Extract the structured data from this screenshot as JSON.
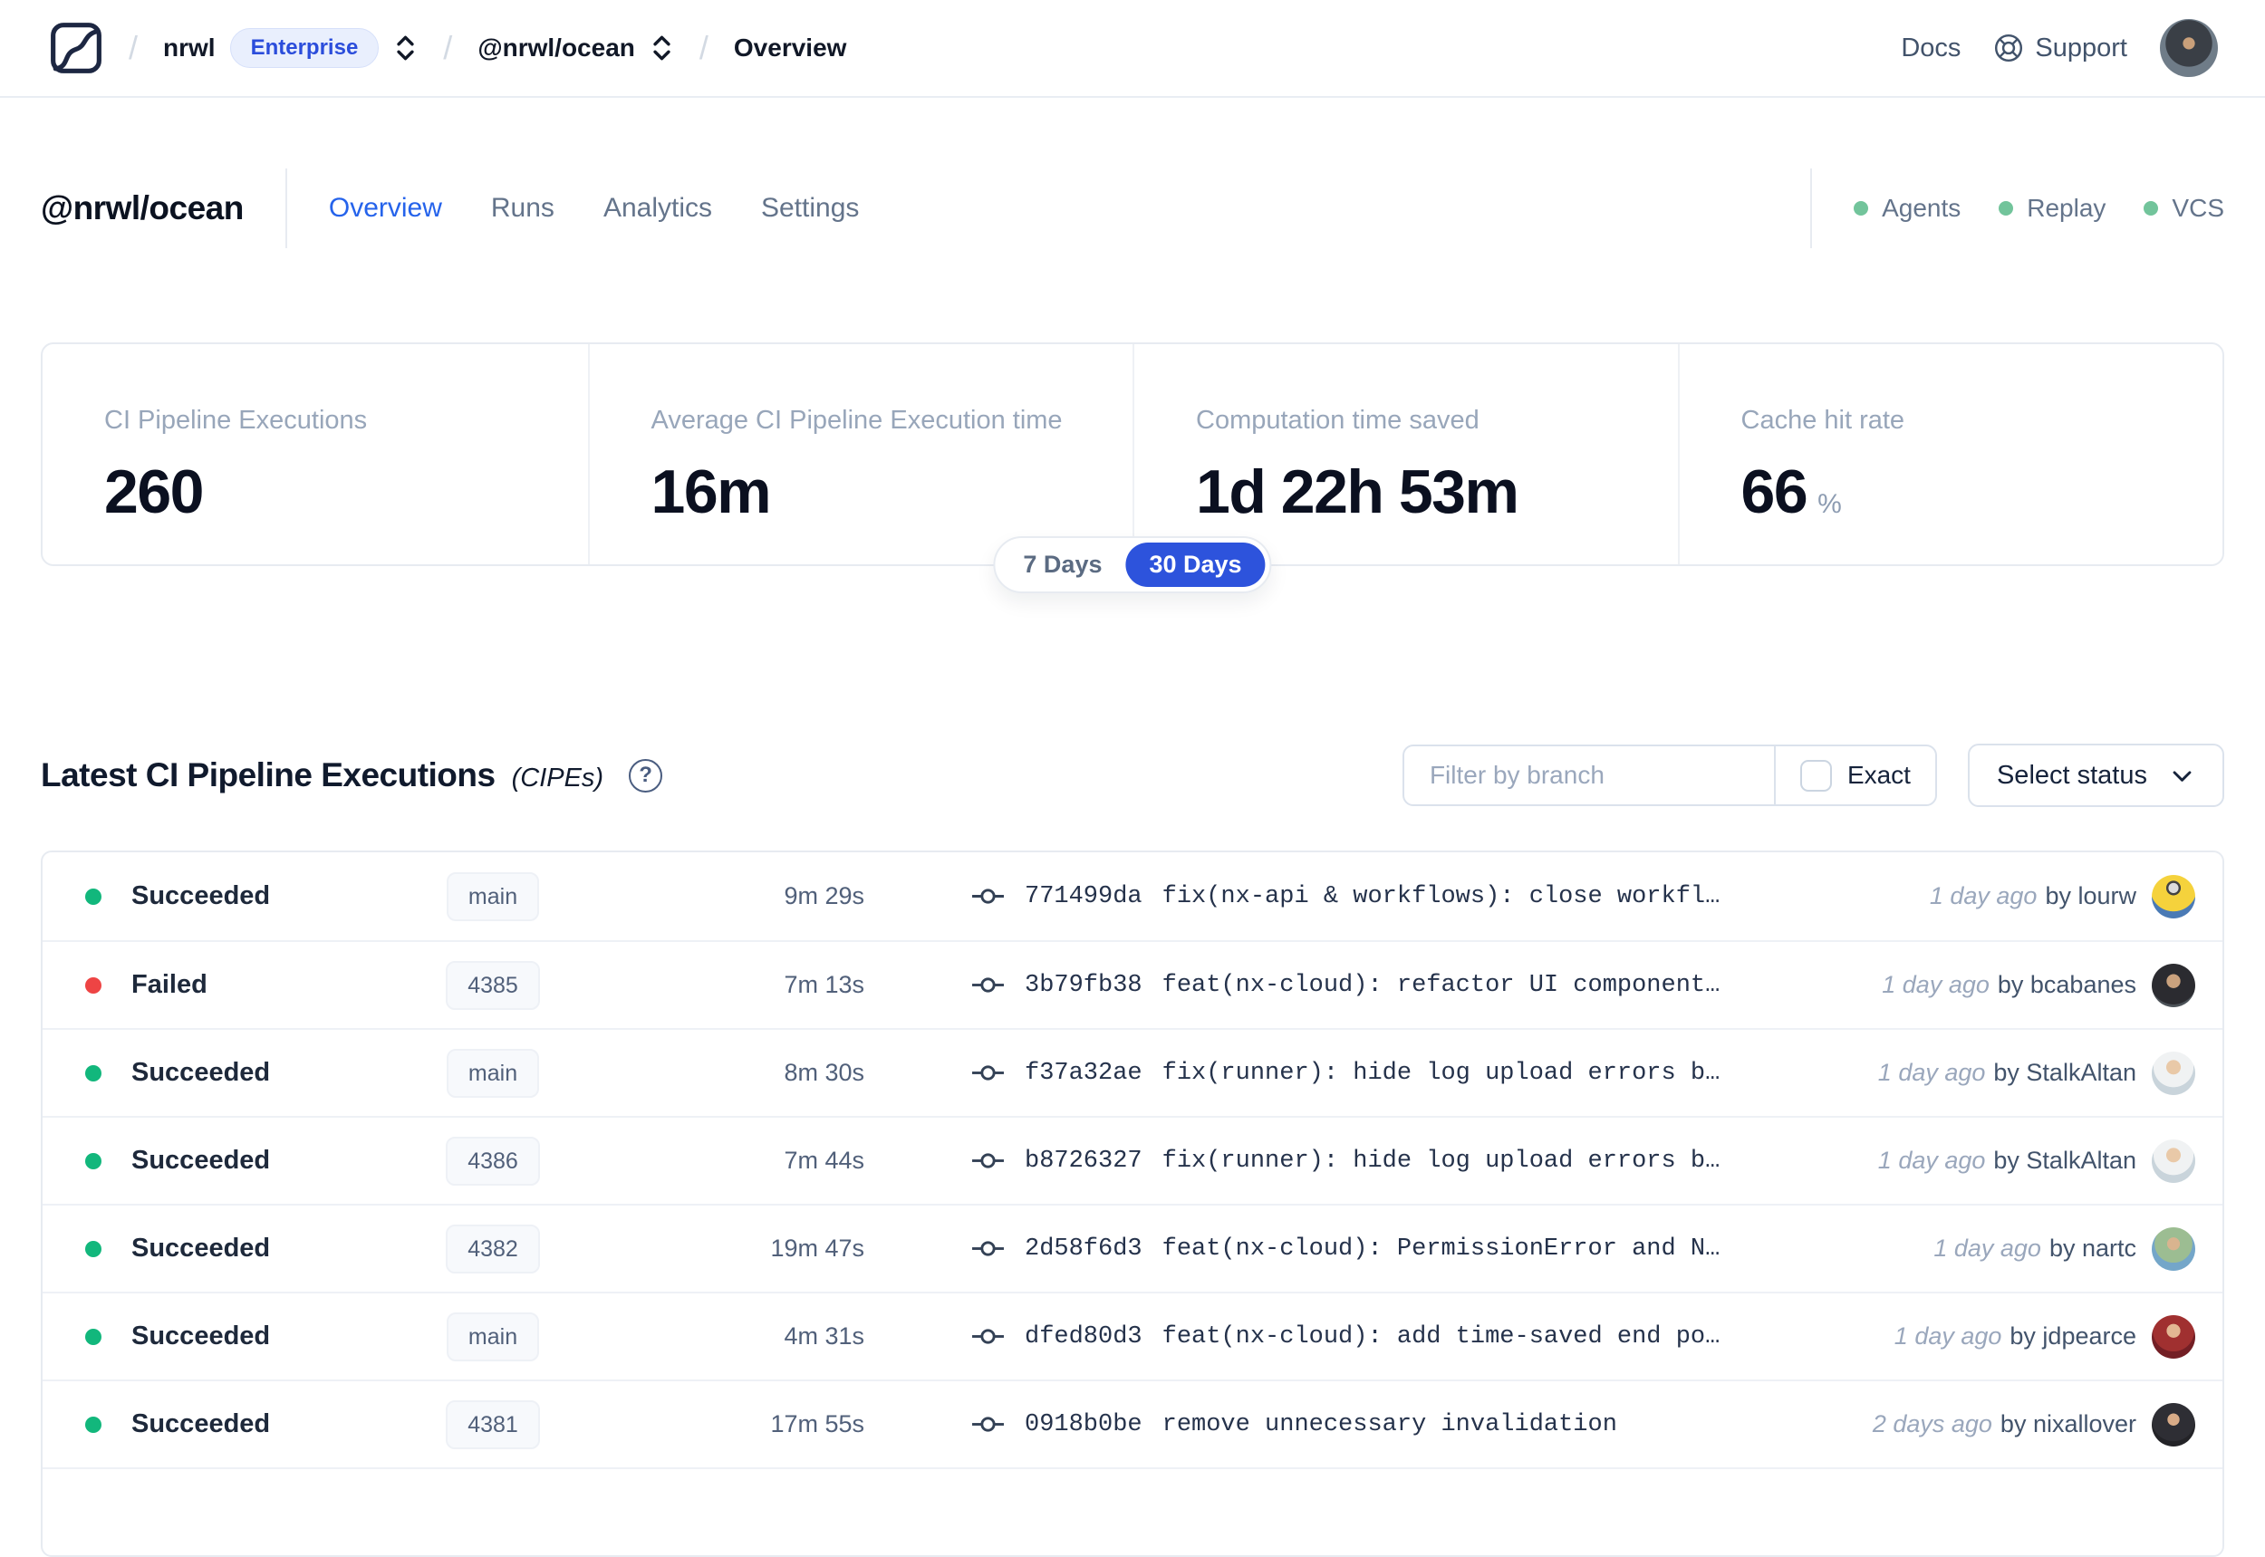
{
  "nav": {
    "breadcrumb": {
      "org": "nrwl",
      "org_badge": "Enterprise",
      "workspace": "@nrwl/ocean",
      "page": "Overview"
    },
    "docs_label": "Docs",
    "support_label": "Support"
  },
  "header": {
    "title": "@nrwl/ocean",
    "tabs": [
      {
        "label": "Overview",
        "active": true
      },
      {
        "label": "Runs",
        "active": false
      },
      {
        "label": "Analytics",
        "active": false
      },
      {
        "label": "Settings",
        "active": false
      }
    ],
    "services": [
      {
        "label": "Agents",
        "status": "online"
      },
      {
        "label": "Replay",
        "status": "online"
      },
      {
        "label": "VCS",
        "status": "online"
      }
    ]
  },
  "stats": [
    {
      "label": "CI Pipeline Executions",
      "value": "260",
      "suffix": ""
    },
    {
      "label": "Average CI Pipeline Execution time",
      "value": "16m",
      "suffix": ""
    },
    {
      "label": "Computation time saved",
      "value": "1d 22h 53m",
      "suffix": ""
    },
    {
      "label": "Cache hit rate",
      "value": "66",
      "suffix": "%"
    }
  ],
  "time_range": {
    "options": [
      "7 Days",
      "30 Days"
    ],
    "selected": "30 Days"
  },
  "cipes": {
    "title": "Latest CI Pipeline Executions",
    "subtitle": "(CIPEs)",
    "filter": {
      "branch_placeholder": "Filter by branch",
      "exact_label": "Exact",
      "status_label": "Select status"
    },
    "rows": [
      {
        "status": "Succeeded",
        "branch": "main",
        "duration": "9m 29s",
        "hash": "771499da",
        "message": "fix(nx-api & workflows): close workfl…",
        "ago": "1 day ago",
        "author": "by lourw"
      },
      {
        "status": "Failed",
        "branch": "4385",
        "duration": "7m 13s",
        "hash": "3b79fb38",
        "message": "feat(nx-cloud): refactor UI component…",
        "ago": "1 day ago",
        "author": "by bcabanes"
      },
      {
        "status": "Succeeded",
        "branch": "main",
        "duration": "8m 30s",
        "hash": "f37a32ae",
        "message": "fix(runner): hide log upload errors b…",
        "ago": "1 day ago",
        "author": "by StalkAltan"
      },
      {
        "status": "Succeeded",
        "branch": "4386",
        "duration": "7m 44s",
        "hash": "b8726327",
        "message": "fix(runner): hide log upload errors b…",
        "ago": "1 day ago",
        "author": "by StalkAltan"
      },
      {
        "status": "Succeeded",
        "branch": "4382",
        "duration": "19m 47s",
        "hash": "2d58f6d3",
        "message": "feat(nx-cloud): PermissionError and N…",
        "ago": "1 day ago",
        "author": "by nartc"
      },
      {
        "status": "Succeeded",
        "branch": "main",
        "duration": "4m 31s",
        "hash": "dfed80d3",
        "message": "feat(nx-cloud): add time-saved end po…",
        "ago": "1 day ago",
        "author": "by jdpearce"
      },
      {
        "status": "Succeeded",
        "branch": "4381",
        "duration": "17m 55s",
        "hash": "0918b0be",
        "message": "remove unnecessary invalidation",
        "ago": "2 days ago",
        "author": "by nixallover"
      }
    ]
  },
  "colors": {
    "accent_blue": "#2563eb",
    "toggle_blue": "#2d53dc",
    "enterprise_badge_blue": "#2b4ddb",
    "success_green": "#12b77c",
    "failed_red": "#ee4444",
    "service_green": "#72c49b"
  }
}
